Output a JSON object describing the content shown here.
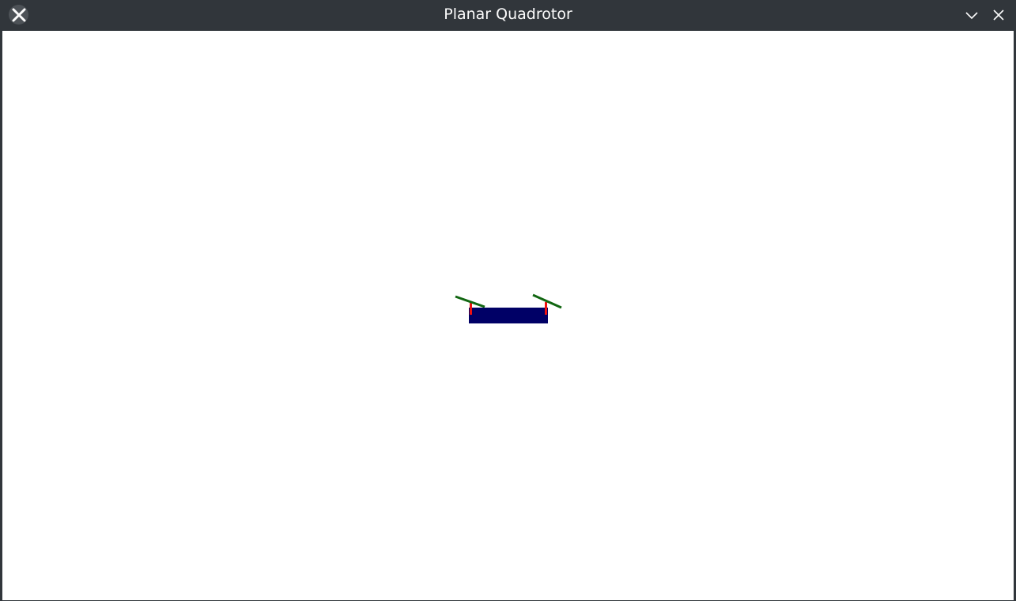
{
  "window": {
    "title": "Planar Quadrotor",
    "app_icon": "x-logo-icon",
    "controls": {
      "minimize_icon": "chevron-down-icon",
      "close_icon": "close-icon"
    }
  },
  "scene": {
    "background_color": "#ffffff",
    "body_color": "#000066",
    "arm_color": "#ee1111",
    "rotor_color": "#116611"
  }
}
